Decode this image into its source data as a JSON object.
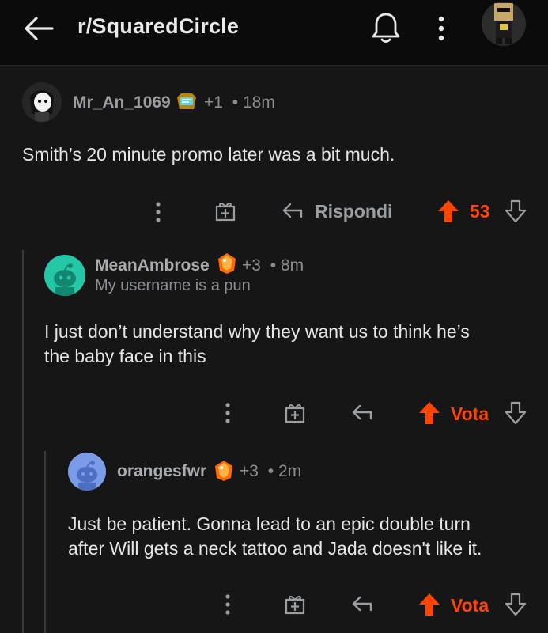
{
  "header": {
    "subreddit": "r/SquaredCircle"
  },
  "comments": [
    {
      "username": "Mr_An_1069",
      "award_count": "+1",
      "time": "• 18m",
      "flair": "",
      "body": "Smith’s 20 minute promo later was a bit much.",
      "reply_label": "Rispondi",
      "score": "53"
    },
    {
      "username": "MeanAmbrose",
      "award_count": "+3",
      "time": "• 8m",
      "flair": "My username is a pun",
      "body_line1": "I just don’t understand why they want us to think he’s",
      "body_line2": "the baby face in this",
      "vote_label": "Vota"
    },
    {
      "username": "orangesfwr",
      "award_count": "+3",
      "time": "• 2m",
      "body_line1": "Just be patient.  Gonna lead to an epic double turn",
      "body_line2": "after Will gets a neck tattoo and Jada doesn't like it.",
      "vote_label": "Vota"
    }
  ],
  "colors": {
    "background": "#161616",
    "upvote_active": "#ff4500",
    "text": "#e4e6e8",
    "muted": "#8b8f93"
  },
  "icons": [
    "back-arrow-icon",
    "bell-icon",
    "more-icon",
    "gift-icon",
    "reply-icon",
    "upvote-icon",
    "downvote-icon"
  ]
}
